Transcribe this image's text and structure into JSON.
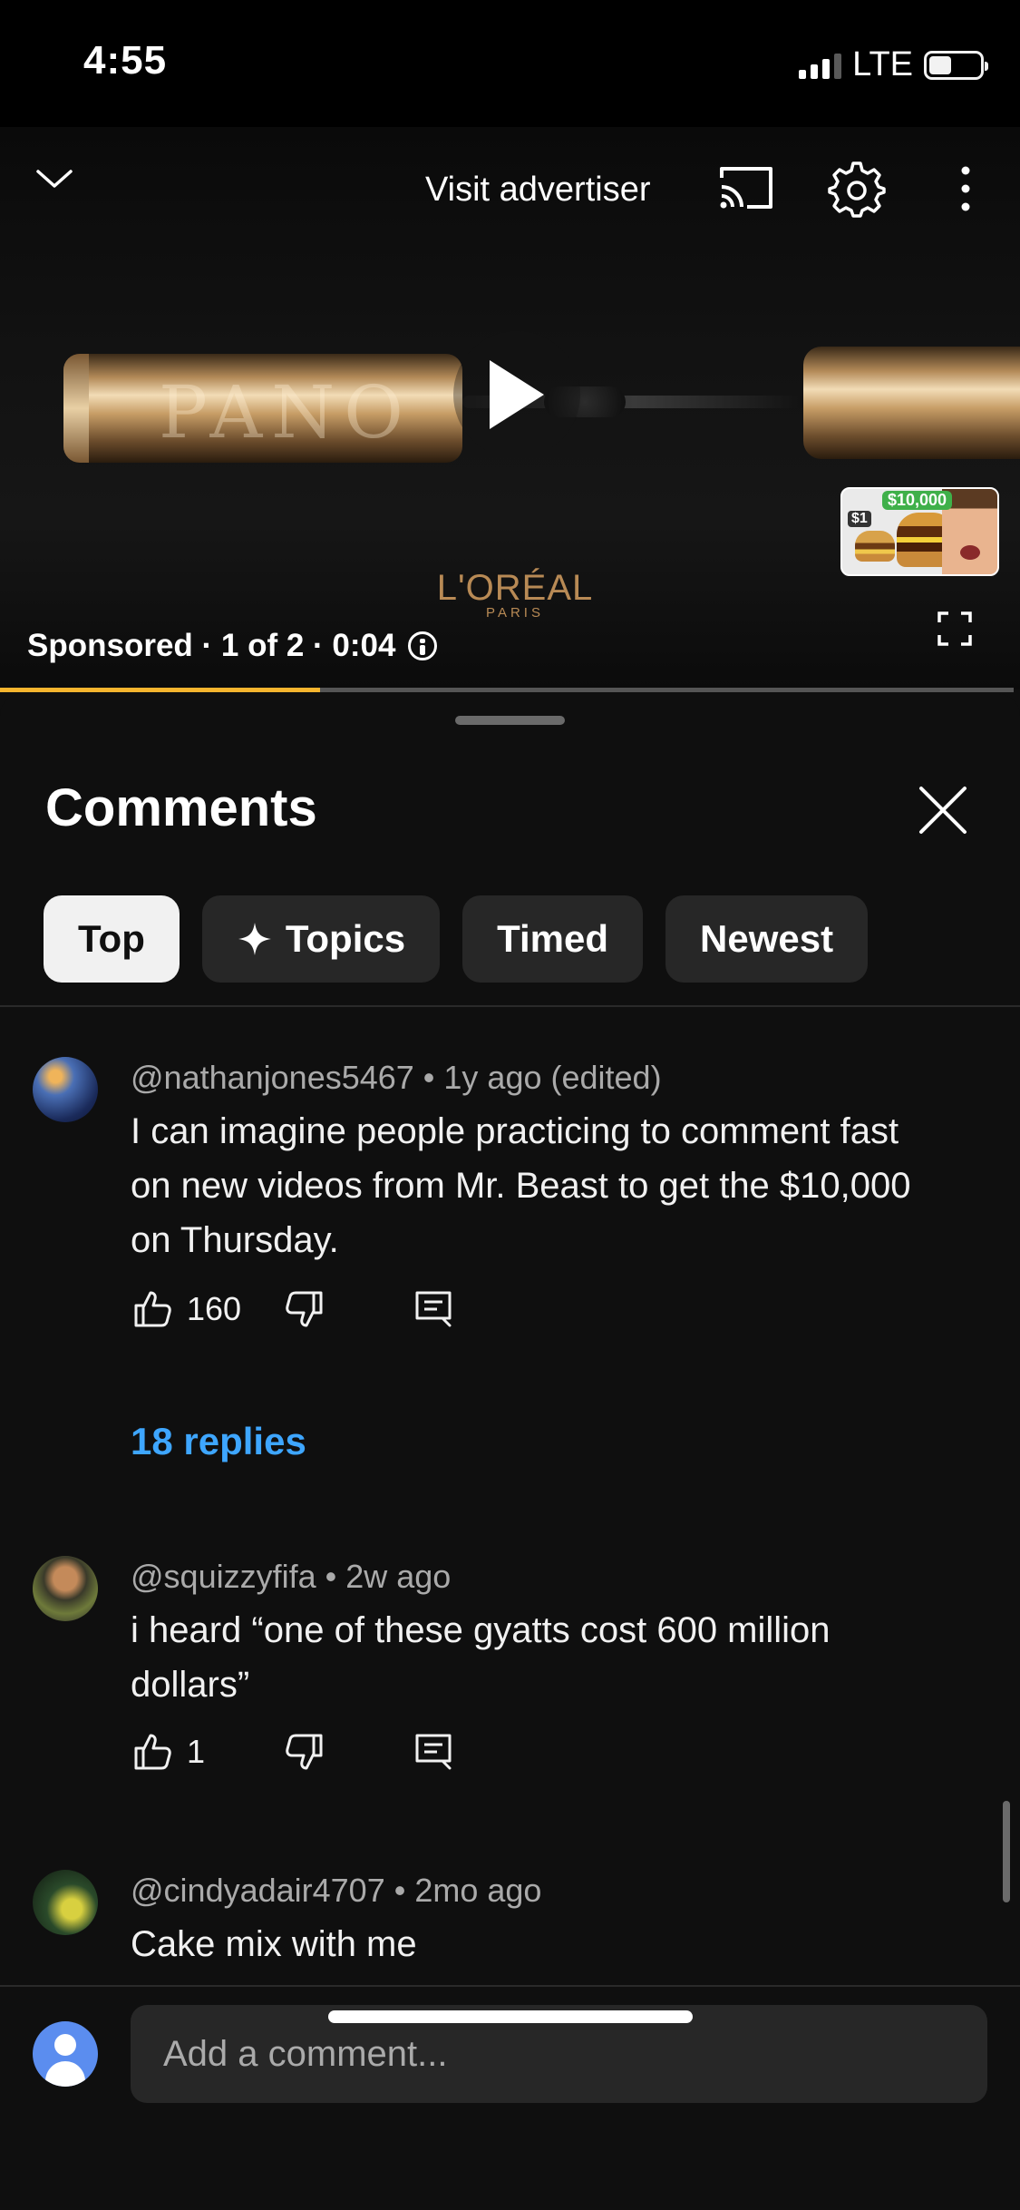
{
  "status_bar": {
    "time": "4:55",
    "network": "LTE",
    "battery_level": 0.3
  },
  "ad": {
    "visit_advertiser": "Visit advertiser",
    "meta": "Sponsored · 1 of 2 · 0:04",
    "brand": "L'ORÉAL",
    "brand_sub": "PARIS",
    "product_text": "PANO",
    "progress": 0.31,
    "next_thumb": {
      "money": "$10,000",
      "price": "$1"
    }
  },
  "comments_panel": {
    "title": "Comments",
    "chips": [
      {
        "label": "Top",
        "active": true
      },
      {
        "label": "Topics",
        "icon": "sparkle-icon"
      },
      {
        "label": "Timed"
      },
      {
        "label": "Newest"
      }
    ],
    "comments": [
      {
        "handle": "@nathanjones5467",
        "time": "1y ago (edited)",
        "meta": "@nathanjones5467 • 1y ago (edited)",
        "text": "I can imagine people practicing to comment fast on new videos from Mr. Beast to get the $10,000 on Thursday.",
        "likes": "160",
        "replies": "18 replies"
      },
      {
        "handle": "@squizzyfifa",
        "time": "2w ago",
        "meta": "@squizzyfifa • 2w ago",
        "text": "i heard “one of these gyatts cost 600 million dollars”",
        "likes": "1"
      },
      {
        "handle": "@cindyadair4707",
        "time": "2mo ago",
        "meta": "@cindyadair4707 • 2mo ago",
        "text": "Cake mix with me"
      }
    ],
    "composer_placeholder": "Add a comment..."
  },
  "colors": {
    "accent_link": "#3ea6ff",
    "progress": "#f6b52e",
    "background": "#0f0f0f",
    "chip": "#272727"
  }
}
